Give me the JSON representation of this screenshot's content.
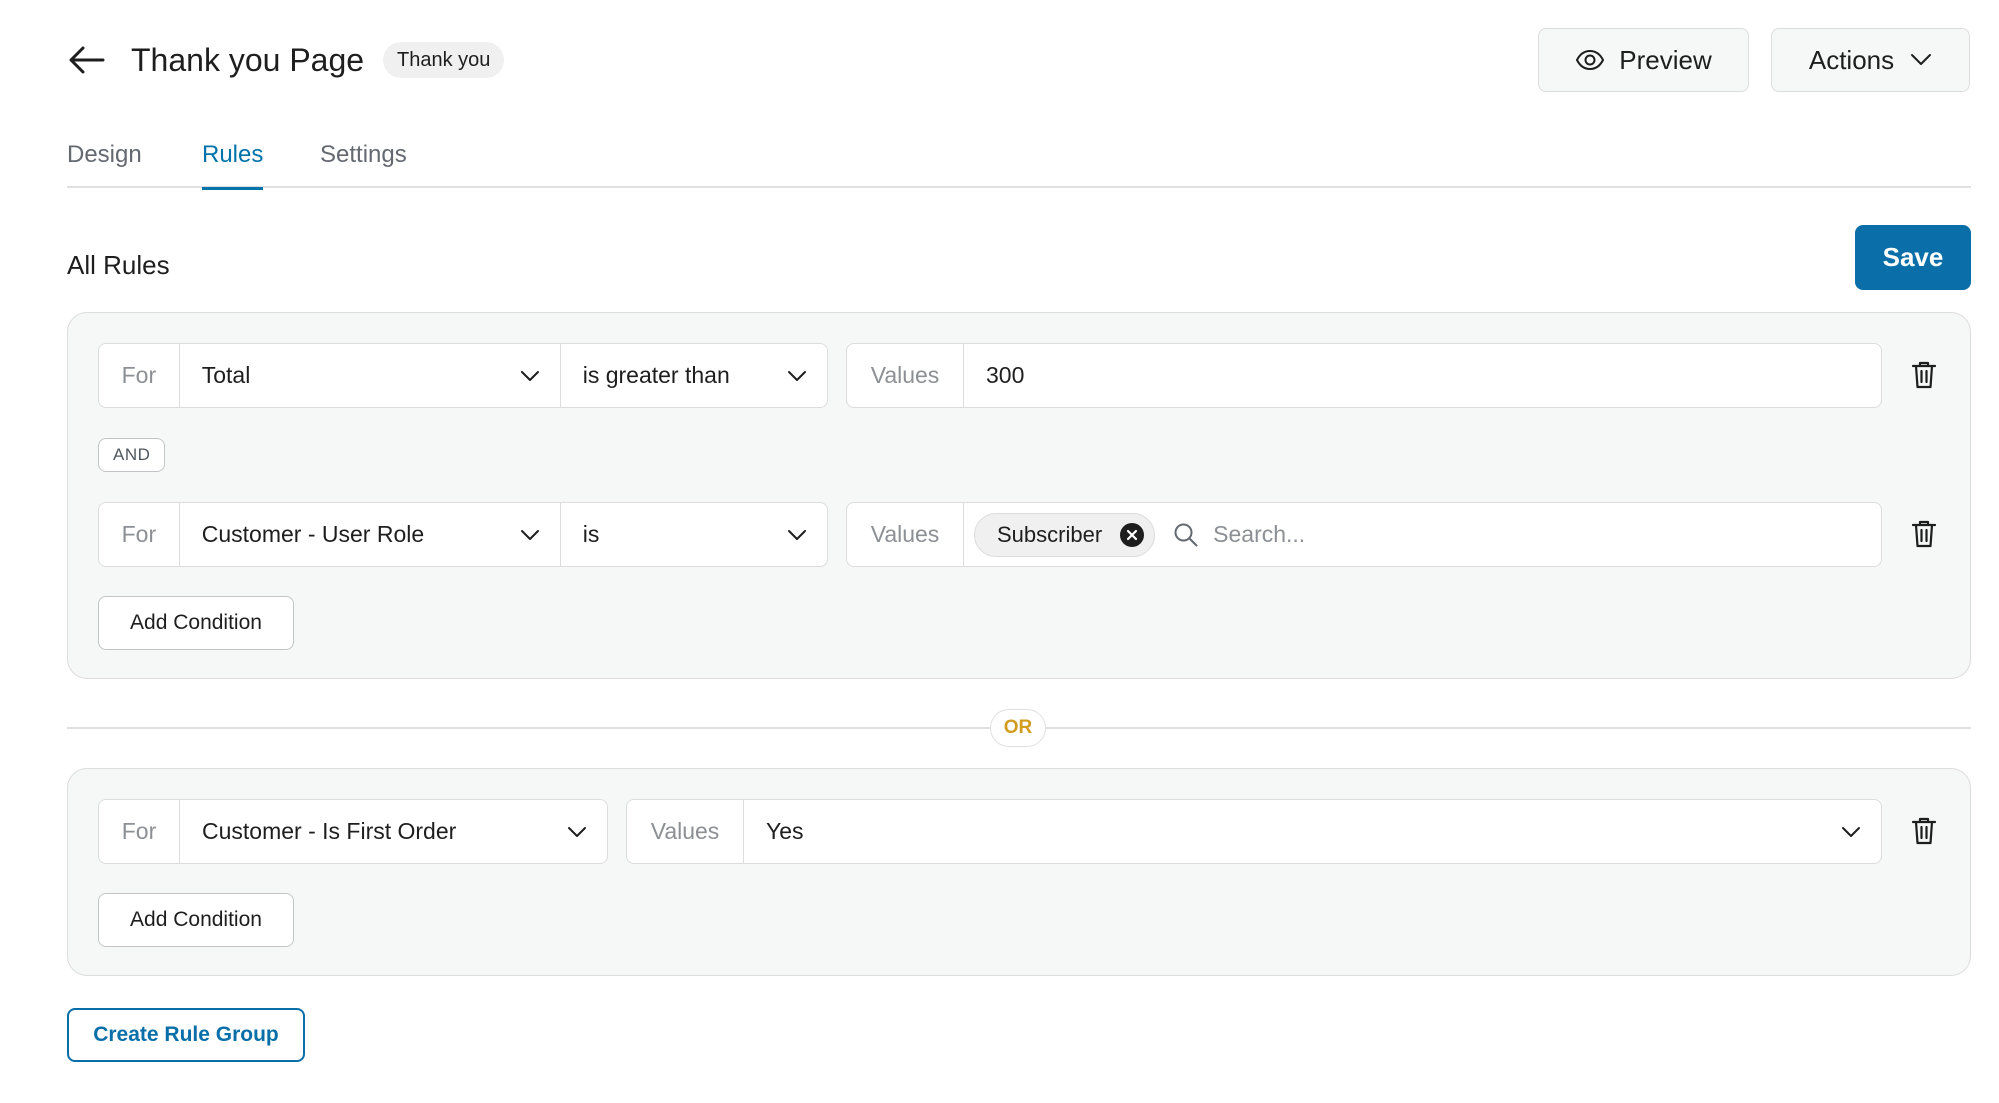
{
  "header": {
    "title": "Thank you Page",
    "badge": "Thank you",
    "preview_label": "Preview",
    "actions_label": "Actions"
  },
  "tabs": [
    {
      "label": "Design",
      "active": false
    },
    {
      "label": "Rules",
      "active": true
    },
    {
      "label": "Settings",
      "active": false
    }
  ],
  "section": {
    "title": "All Rules",
    "save_label": "Save"
  },
  "groups": [
    {
      "rules": [
        {
          "for_label": "For",
          "field": "Total",
          "condition": "is greater than",
          "values_label": "Values",
          "value": "300"
        },
        {
          "for_label": "For",
          "field": "Customer - User Role",
          "condition": "is",
          "values_label": "Values",
          "tags": [
            "Subscriber"
          ],
          "search_placeholder": "Search..."
        }
      ],
      "connector": "AND",
      "add_condition_label": "Add Condition"
    },
    {
      "rules": [
        {
          "for_label": "For",
          "field": "Customer - Is First Order",
          "values_label": "Values",
          "value": "Yes"
        }
      ],
      "add_condition_label": "Add Condition"
    }
  ],
  "or_label": "OR",
  "create_group_label": "Create Rule Group",
  "colors": {
    "accent": "#0a6fa8",
    "or_text": "#d19c20",
    "group_bg": "#f6f7f7",
    "border": "#dcdcde"
  },
  "icons": {
    "back": "arrow-left-icon",
    "preview": "eye-icon",
    "dropdown": "chevron-down-icon",
    "delete": "trash-icon",
    "remove_tag": "close-circle-icon",
    "search": "search-icon"
  }
}
